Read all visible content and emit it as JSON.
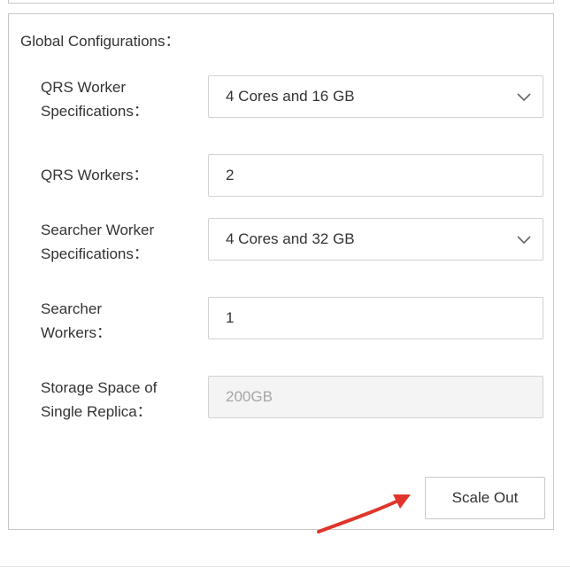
{
  "section": {
    "title": "Global Configurations："
  },
  "fields": {
    "qrs_spec": {
      "label_line1": "QRS Worker",
      "label_line2": "Specifications：",
      "value": "4 Cores and 16 GB",
      "icon": "chevron-down-icon"
    },
    "qrs_workers": {
      "label": "QRS Workers：",
      "value": "2"
    },
    "searcher_spec": {
      "label_line1": "Searcher Worker",
      "label_line2": "Specifications：",
      "value": "4 Cores and 32 GB",
      "icon": "chevron-down-icon"
    },
    "searcher_workers": {
      "label_line1": "Searcher",
      "label_line2": "Workers：",
      "value": "1"
    },
    "storage": {
      "label_line1": "Storage Space of",
      "label_line2": "Single Replica：",
      "value": "200GB",
      "disabled": true
    }
  },
  "actions": {
    "scale_out_label": "Scale Out"
  },
  "annotation": {
    "arrow_color": "#e0352b"
  },
  "colors": {
    "border": "#c8c8c8",
    "text": "#333333",
    "disabled_bg": "#f4f4f4",
    "disabled_text": "#a6a6a6"
  }
}
